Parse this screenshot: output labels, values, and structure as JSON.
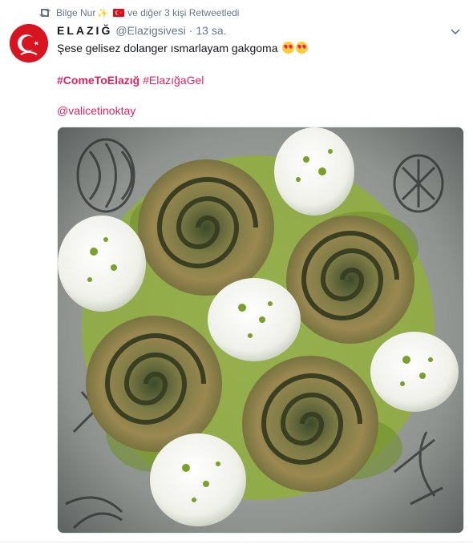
{
  "retweet": {
    "user_name": "Bilge Nur",
    "suffix_text": "ve diğer 3 kişi Retweetledi",
    "icon": "retweet-icon"
  },
  "tweet": {
    "display_name": "ELAZIĞ",
    "handle": "@Elazigsivesi",
    "separator": "·",
    "time": "13 sa.",
    "text": "Şese gelisez dolanger ısmarlayam gakgoma",
    "emoji": "smiling-face-with-heart-eyes",
    "hashtags": [
      "#ComeToElazığ",
      "#ElazığaGel"
    ],
    "mention": "@valicetinoktay",
    "menu_icon": "chevron-down-icon",
    "image_alt": "Spiral pistachio baklava rolls with scoops of ice cream topped with crushed pistachio on an engraved metal tray"
  },
  "colors": {
    "accent": "#e0245e",
    "muted": "#657786",
    "text": "#14171a",
    "flag": "#e30a17"
  }
}
